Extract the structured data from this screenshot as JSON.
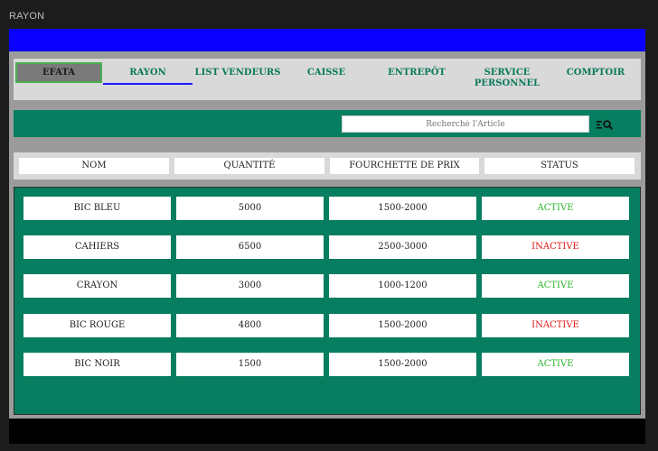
{
  "window": {
    "title": "RAYON"
  },
  "nav": {
    "items": [
      {
        "label": "EFATA"
      },
      {
        "label": "RAYON"
      },
      {
        "label": "LIST VENDEURS"
      },
      {
        "label": "CAISSE"
      },
      {
        "label": "ENTREPÔT"
      },
      {
        "label": "SERVICE PERSONNEL"
      },
      {
        "label": "COMPTOIR"
      }
    ]
  },
  "search": {
    "placeholder": "Recherché l'Article"
  },
  "colors": {
    "accent_green": "#067e5f",
    "top_bar_blue": "#0a00ff",
    "status_active": "#2ab52a",
    "status_inactive": "#e01515"
  },
  "table": {
    "columns": [
      "NOM",
      "QUANTITÉ",
      "FOURCHETTE DE PRIX",
      "STATUS"
    ],
    "rows": [
      {
        "nom": "BIC BLEU",
        "quantite": "5000",
        "prix": "1500-2000",
        "status": "ACTIVE"
      },
      {
        "nom": "CAHIERS",
        "quantite": "6500",
        "prix": "2500-3000",
        "status": "INACTIVE"
      },
      {
        "nom": "CRAYON",
        "quantite": "3000",
        "prix": "1000-1200",
        "status": "ACTIVE"
      },
      {
        "nom": "BIC ROUGE",
        "quantite": "4800",
        "prix": "1500-2000",
        "status": "INACTIVE"
      },
      {
        "nom": "BIC NOIR",
        "quantite": "1500",
        "prix": "1500-2000",
        "status": "ACTIVE"
      }
    ]
  }
}
